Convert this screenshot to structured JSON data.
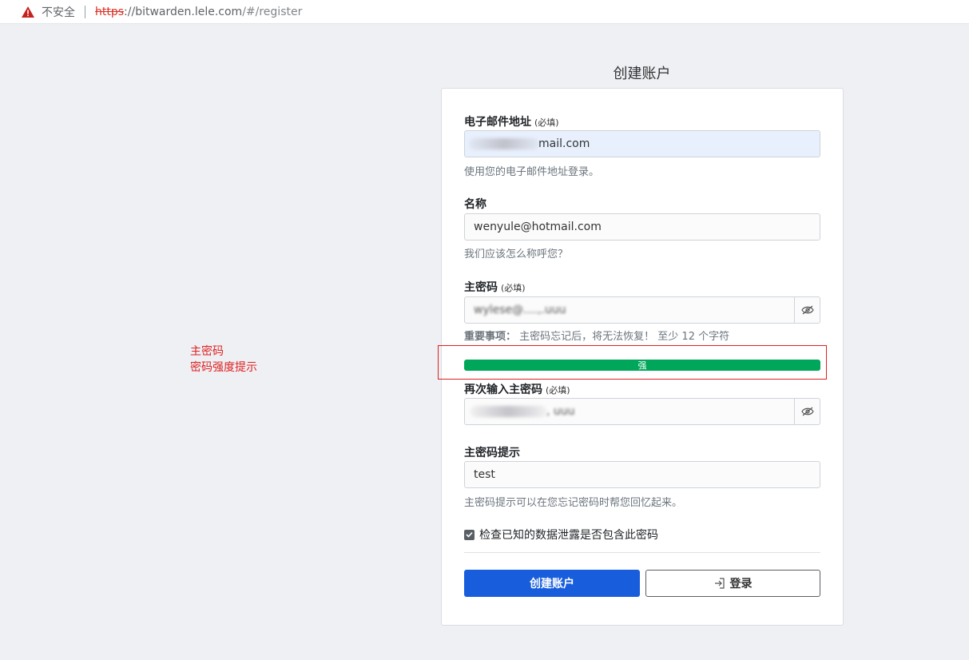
{
  "browser": {
    "security_label": "不安全",
    "url_scheme": "https",
    "url_host": "://bitwarden.lele.com",
    "url_path": "/#/register"
  },
  "annotation": {
    "line1": "主密码",
    "line2": "密码强度提示"
  },
  "page": {
    "title": "创建账户"
  },
  "form": {
    "email": {
      "label": "电子邮件地址",
      "required": "(必填)",
      "value_visible": "mail.com",
      "hint": "使用您的电子邮件地址登录。"
    },
    "name": {
      "label": "名称",
      "value": "wenyule@hotmail.com",
      "hint": "我们应该怎么称呼您？"
    },
    "master_password": {
      "label": "主密码",
      "required": "(必填)",
      "value": "wylese@....,.uuu",
      "hint_strong": "重要事项：",
      "hint": "主密码忘记后，将无法恢复！ 至少 12 个字符",
      "strength": "强",
      "strength_level": 1.0
    },
    "master_password_retype": {
      "label": "再次输入主密码",
      "required": "(必填)",
      "value": ", uuu"
    },
    "password_hint": {
      "label": "主密码提示",
      "value": "test",
      "hint": "主密码提示可以在您忘记密码时帮您回忆起来。"
    },
    "breach_check": {
      "label": "检查已知的数据泄露是否包含此密码",
      "checked": true
    },
    "submit_label": "创建账户",
    "login_label": "登录"
  },
  "colors": {
    "primary": "#175ddc",
    "strength_strong": "#00a65a",
    "annotation": "#e02020"
  }
}
